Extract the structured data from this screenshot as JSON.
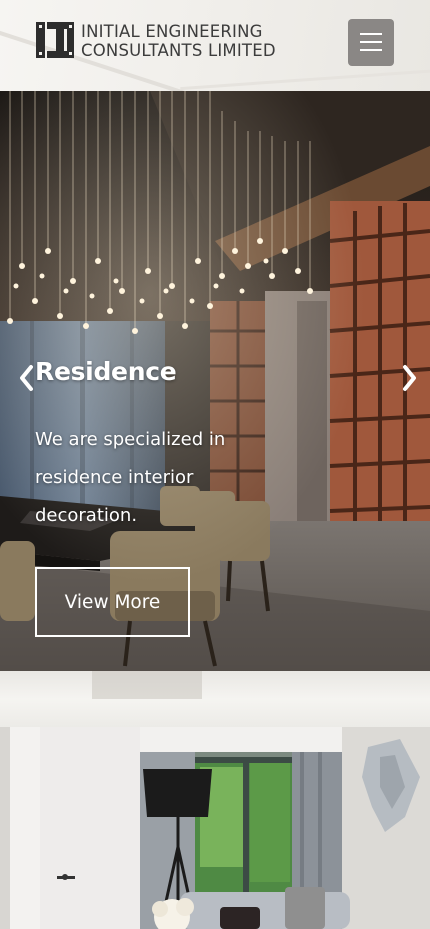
{
  "header": {
    "brand_line1": "INITIAL ENGINEERING",
    "brand_line2": "CONSULTANTS LIMITED",
    "logo_icon": "ie-logo-icon",
    "menu_icon": "hamburger-menu-icon"
  },
  "hero": {
    "title": "Residence",
    "description": "We are specialized in residence interior decoration.",
    "button_label": "View More",
    "prev_icon": "chevron-left-icon",
    "next_icon": "chevron-right-icon"
  },
  "colors": {
    "menu_button": "#8a8785",
    "brand_text": "#3c3c3c",
    "hero_text": "#ffffff"
  }
}
